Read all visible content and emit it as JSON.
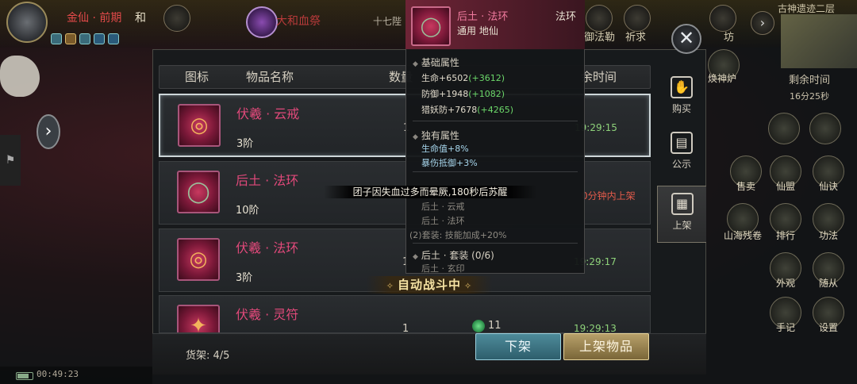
{
  "hud": {
    "player_name": "金仙 · 前期",
    "player_tag": "和",
    "event_title": "大和血祭",
    "event_sub": "十七陛",
    "top_buttons": [
      {
        "label": "御法勒",
        "icon": "sword-icon"
      },
      {
        "label": "祈求",
        "icon": "pray-icon"
      },
      {
        "label": "坊",
        "icon": "workshop-icon"
      }
    ],
    "zone_name": "古神遗迹二层",
    "clock": "00:49:23"
  },
  "panel": {
    "columns": [
      "图标",
      "物品名称",
      "数量",
      "余时间"
    ],
    "rows": [
      {
        "name": "伏羲 · 云戒",
        "rank": "3阶",
        "qty": "1",
        "price": "",
        "time": "19:29:15",
        "status": "",
        "selected": true,
        "icon": "ring-icon",
        "glyph": "◎"
      },
      {
        "name": "后土 · 法环",
        "rank": "10阶",
        "qty": "",
        "price": "",
        "time": "",
        "status": "0分钟内上架",
        "selected": false,
        "icon": "bracelet-icon",
        "glyph": "◯"
      },
      {
        "name": "伏羲 · 法环",
        "rank": "3阶",
        "qty": "1",
        "price": "",
        "time": "19:29:17",
        "status": "",
        "selected": false,
        "icon": "ring-icon",
        "glyph": "◎"
      },
      {
        "name": "伏羲 · 灵符",
        "rank": "",
        "qty": "1",
        "price": "11",
        "time": "19:29:13",
        "status": "",
        "selected": false,
        "icon": "talisman-icon",
        "glyph": "✦"
      }
    ],
    "shelf_count": "货架: 4/5",
    "remove_button": "下架",
    "list_button": "上架物品"
  },
  "tabs": [
    {
      "label": "购买",
      "icon": "purchase-icon",
      "glyph": "✋",
      "active": false
    },
    {
      "label": "公示",
      "icon": "notice-icon",
      "glyph": "▤",
      "active": false
    },
    {
      "label": "上架",
      "icon": "listing-icon",
      "glyph": "▦",
      "active": true
    }
  ],
  "right_menu": {
    "remain_title": "剩余时间",
    "remain_value": "16分25秒",
    "items": [
      {
        "label": "售卖",
        "icon": "sell-icon"
      },
      {
        "label": "仙盟",
        "icon": "alliance-icon"
      },
      {
        "label": "仙诀",
        "icon": "scroll-icon"
      },
      {
        "label": "山海残卷",
        "icon": "map-scroll-icon"
      },
      {
        "label": "排行",
        "icon": "ranking-icon"
      },
      {
        "label": "功法",
        "icon": "taiji-icon"
      },
      {
        "label": "外观",
        "icon": "outfit-icon"
      },
      {
        "label": "随从",
        "icon": "follower-icon"
      },
      {
        "label": "手记",
        "icon": "notebook-icon"
      },
      {
        "label": "设置",
        "icon": "gear-icon"
      }
    ],
    "top_extra": "焕神炉"
  },
  "tooltip": {
    "name": "后土 · 法环",
    "type": "法环",
    "usage": "通用 地仙",
    "base_title": "基础属性",
    "base_stats": [
      {
        "label": "生命+6502",
        "bonus": "(+3612)"
      },
      {
        "label": "防御+1948",
        "bonus": "(+1082)"
      },
      {
        "label": "猎妖防+7678",
        "bonus": "(+4265)"
      }
    ],
    "unique_title": "独有属性",
    "unique_stats": [
      "生命值+8%",
      "暴伤抵御+3%"
    ],
    "set_items": [
      "后土 · 云戒",
      "后土 · 法环"
    ],
    "set_bonus": "(2)套装: 技能加成+20%",
    "set_title": "后土 · 套装 (0/6)",
    "set_next": "后土 · 玄印"
  },
  "notices": {
    "system": "团子因失血过多而晕厥,180秒后苏醒",
    "auto_battle": "自动战斗中"
  },
  "colors": {
    "item_name": "#e0497a",
    "time_ok": "#8ed27a",
    "time_pending": "#e25a4a",
    "stat_bonus": "#6cd86a",
    "exclusive": "#a7d6ec"
  }
}
